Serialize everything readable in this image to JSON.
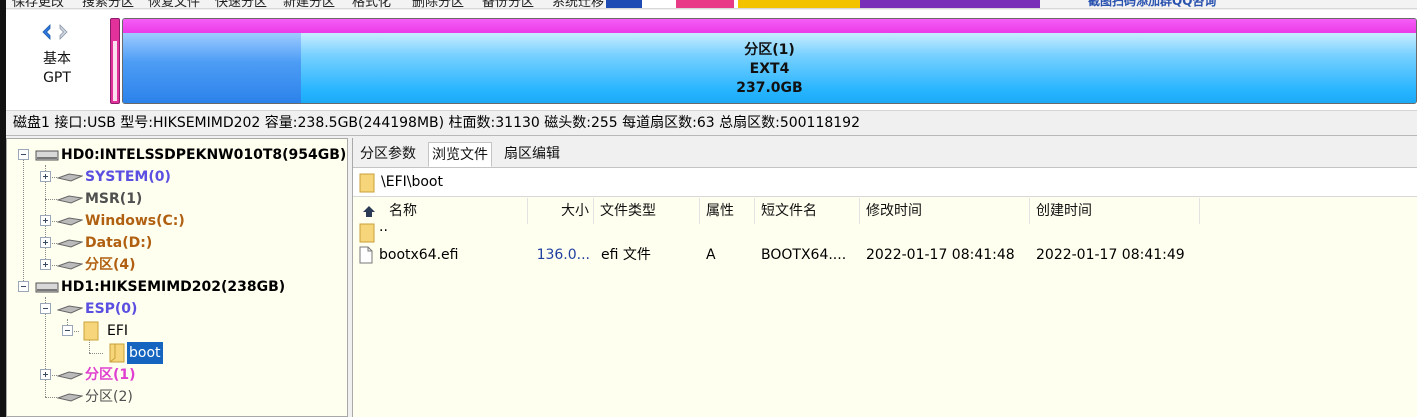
{
  "toolbar": {
    "items": [
      "保存更改",
      "搜索分区",
      "恢复文件",
      "快速分区",
      "新建分区",
      "格式化",
      "删除分区",
      "备份分区",
      "系统迁移"
    ],
    "ad_text": "截图扫码添加群QQ咨询"
  },
  "disk_panel": {
    "type_line1": "基本",
    "type_line2": "GPT",
    "partition": {
      "name": "分区(1)",
      "fs": "EXT4",
      "size": "237.0GB"
    },
    "colors": {
      "selected_bar": "#e2319a",
      "partition_top": "#ea3ae6",
      "partition_body": "#27b4ff"
    }
  },
  "disk_info": "磁盘1 接口:USB  型号:HIKSEMIMD202  容量:238.5GB(244198MB)  柱面数:31130  磁头数:255  每道扇区数:63  总扇区数:500118192",
  "tree": {
    "hd0": "HD0:INTELSSDPEKNW010T8(954GB)",
    "hd0_children": [
      {
        "label": "SYSTEM(0)",
        "color": "#5a4fe0"
      },
      {
        "label": "MSR(1)",
        "color": "#505050"
      },
      {
        "label": "Windows(C:)",
        "color": "#b06010"
      },
      {
        "label": "Data(D:)",
        "color": "#b06010"
      },
      {
        "label": "分区(4)",
        "color": "#b06010"
      }
    ],
    "hd1": "HD1:HIKSEMIMD202(238GB)",
    "esp": "ESP(0)",
    "efi": "EFI",
    "boot": "boot",
    "part1": "分区(1)",
    "part2": "分区(2)",
    "colors": {
      "esp": "#5a4fe0",
      "part1": "#e040d0",
      "part2": "#505050",
      "selected": "#1565c0"
    }
  },
  "tabs": [
    "分区参数",
    "浏览文件",
    "扇区编辑"
  ],
  "active_tab": "浏览文件",
  "path": "\\EFI\\boot",
  "columns": [
    "名称",
    "大小",
    "文件类型",
    "属性",
    "短文件名",
    "修改时间",
    "创建时间"
  ],
  "files": [
    {
      "name": "..",
      "size": "",
      "type": "",
      "attr": "",
      "short": "",
      "modified": "",
      "created": ""
    },
    {
      "name": "bootx64.efi",
      "size": "136.0...",
      "type": "efi 文件",
      "attr": "A",
      "short": "BOOTX64....",
      "modified": "2022-01-17 08:41:48",
      "created": "2022-01-17 08:41:49"
    }
  ]
}
